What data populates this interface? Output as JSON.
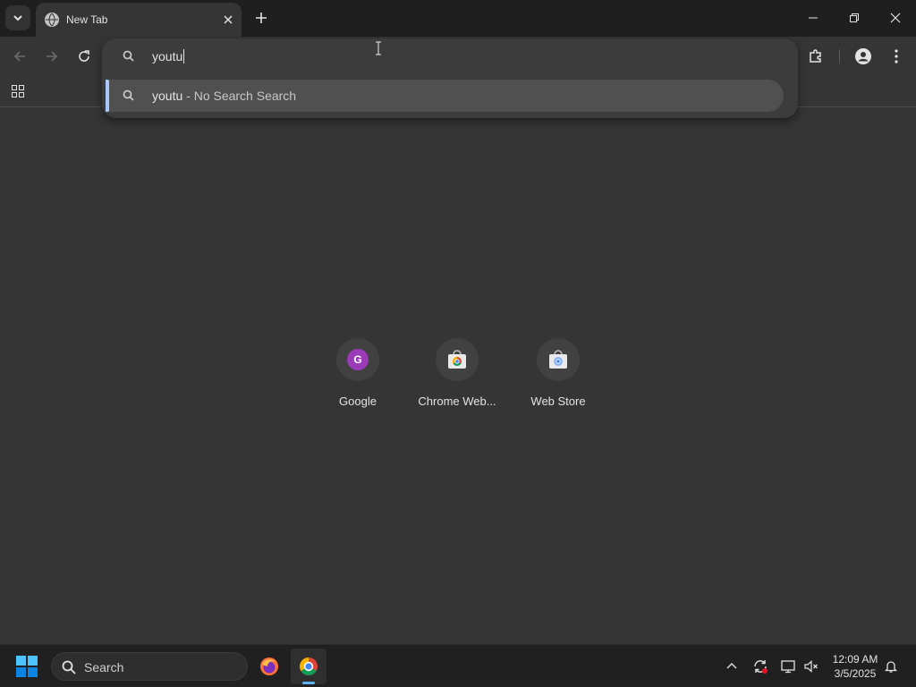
{
  "browser": {
    "tab": {
      "title": "New Tab"
    },
    "omnibox": {
      "input_value": "youtu",
      "suggestion": {
        "query": "youtu",
        "separator": " - ",
        "description": "No Search Search"
      }
    }
  },
  "shortcuts": [
    {
      "label": "Google",
      "letter": "G",
      "icon": "google-letter-icon"
    },
    {
      "label": "Chrome Web...",
      "icon": "chrome-web-store-icon"
    },
    {
      "label": "Web Store",
      "icon": "chrome-web-store-icon"
    }
  ],
  "taskbar": {
    "search_label": "Search",
    "clock_time": "12:09 AM",
    "clock_date": "3/5/2025"
  },
  "colors": {
    "page_bg": "#353535",
    "titlebar_bg": "#1f1f1f",
    "omnibox_bg": "#3c3c3c",
    "selection_accent": "#a8c7fa",
    "taskbar_bg": "#202020",
    "google_avatar": "#9c3bb8"
  }
}
